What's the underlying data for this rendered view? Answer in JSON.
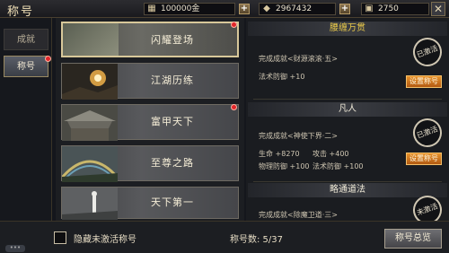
{
  "header": {
    "title": "称号"
  },
  "resources": [
    {
      "icon": "gold-icon",
      "value": "100000金"
    },
    {
      "icon": "diamond-icon",
      "value": "2967432"
    },
    {
      "icon": "ticket-icon",
      "value": "2750"
    }
  ],
  "left_tabs": [
    {
      "label": "成就",
      "active": false
    },
    {
      "label": "称号",
      "active": true
    }
  ],
  "titles": [
    {
      "name": "闪耀登场",
      "selected": true,
      "badge": true
    },
    {
      "name": "江湖历练",
      "selected": false,
      "badge": false
    },
    {
      "name": "富甲天下",
      "selected": false,
      "badge": true
    },
    {
      "name": "至尊之路",
      "selected": false,
      "badge": false
    },
    {
      "name": "天下第一",
      "selected": false,
      "badge": false
    }
  ],
  "details": [
    {
      "name": "腰缠万贯",
      "name_color": "#e8c84a",
      "condition": "完成成就<财源滚滚·五>",
      "stats": [
        "法术防御 +10"
      ],
      "stamp": "已激活",
      "button": "设置称号"
    },
    {
      "name": "凡人",
      "name_color": "#f0ead8",
      "condition": "完成成就<神使下界·二>",
      "stats": [
        "生命 +8270",
        "攻击 +400",
        "物理防御 +100",
        "法术防御 +100"
      ],
      "stamp": "已激活",
      "button": "设置称号"
    },
    {
      "name": "略通道法",
      "name_color": "#f0ead8",
      "condition": "完成成就<除魔卫道·三>",
      "stats": [],
      "stamp": "未激活",
      "button": ""
    }
  ],
  "bottom": {
    "hide_inactive_label": "隐藏未激活称号",
    "hide_inactive_checked": false,
    "count_label": "称号数: 5/37",
    "overview_button": "称号总览"
  },
  "colors": {
    "accent": "#e8932c",
    "badge": "#e0262a",
    "gold_text": "#e8c84a"
  }
}
